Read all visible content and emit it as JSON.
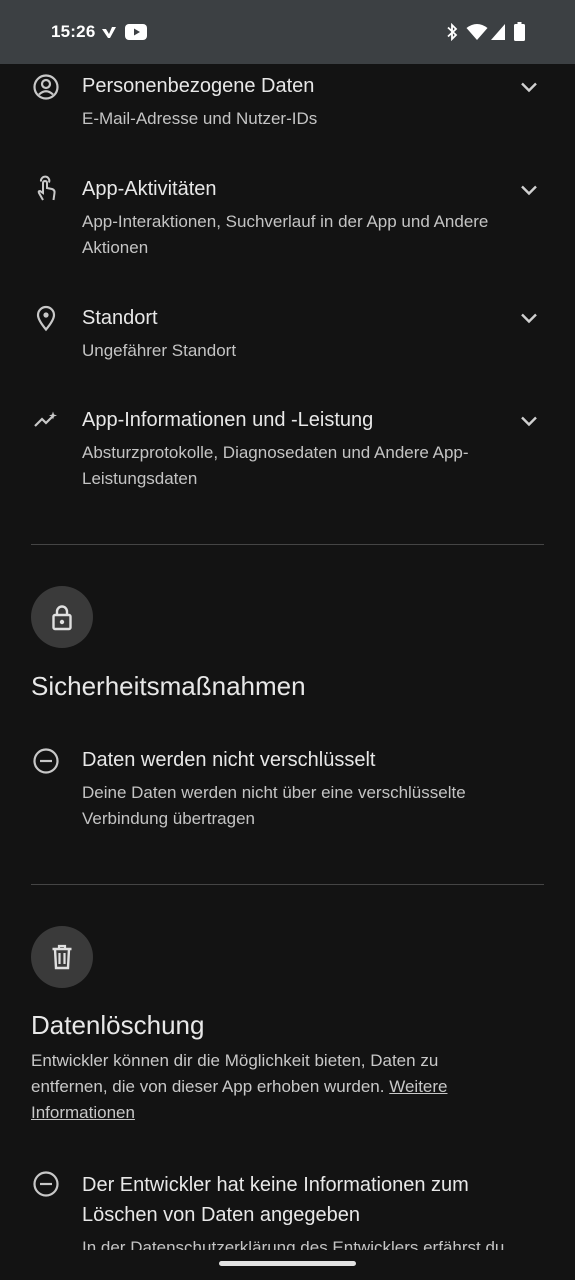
{
  "status_bar": {
    "time": "15:26"
  },
  "data_types": [
    {
      "icon": "account-circle-icon",
      "title": "Personenbezogene Daten",
      "subtitle": "E-Mail-Adresse und Nutzer-IDs"
    },
    {
      "icon": "touch-app-icon",
      "title": "App-Aktivitäten",
      "subtitle": "App-Interaktionen, Suchverlauf in der App und Andere Aktionen"
    },
    {
      "icon": "location-pin-icon",
      "title": "Standort",
      "subtitle": "Ungefährer Standort"
    },
    {
      "icon": "performance-icon",
      "title": "App-Informationen und -Leistung",
      "subtitle": "Absturzprotokolle, Diagnosedaten und Andere App-Leistungsdaten"
    }
  ],
  "security": {
    "icon": "lock-icon",
    "heading": "Sicherheitsmaßnahmen",
    "item": {
      "icon": "minus-circle-icon",
      "title": "Daten werden nicht verschlüsselt",
      "subtitle": "Deine Daten werden nicht über eine verschlüsselte Verbindung übertragen"
    }
  },
  "deletion": {
    "icon": "trash-icon",
    "heading": "Datenlöschung",
    "text": "Entwickler können dir die Möglichkeit bieten, Daten zu entfernen, die von dieser App erhoben wurden.",
    "link": "Weitere Informationen",
    "item": {
      "icon": "minus-circle-icon",
      "title": "Der Entwickler hat keine Informationen zum Löschen von Daten angegeben",
      "subtitle": "In der Datenschutzerklärung des Entwicklers erfährst du"
    }
  }
}
